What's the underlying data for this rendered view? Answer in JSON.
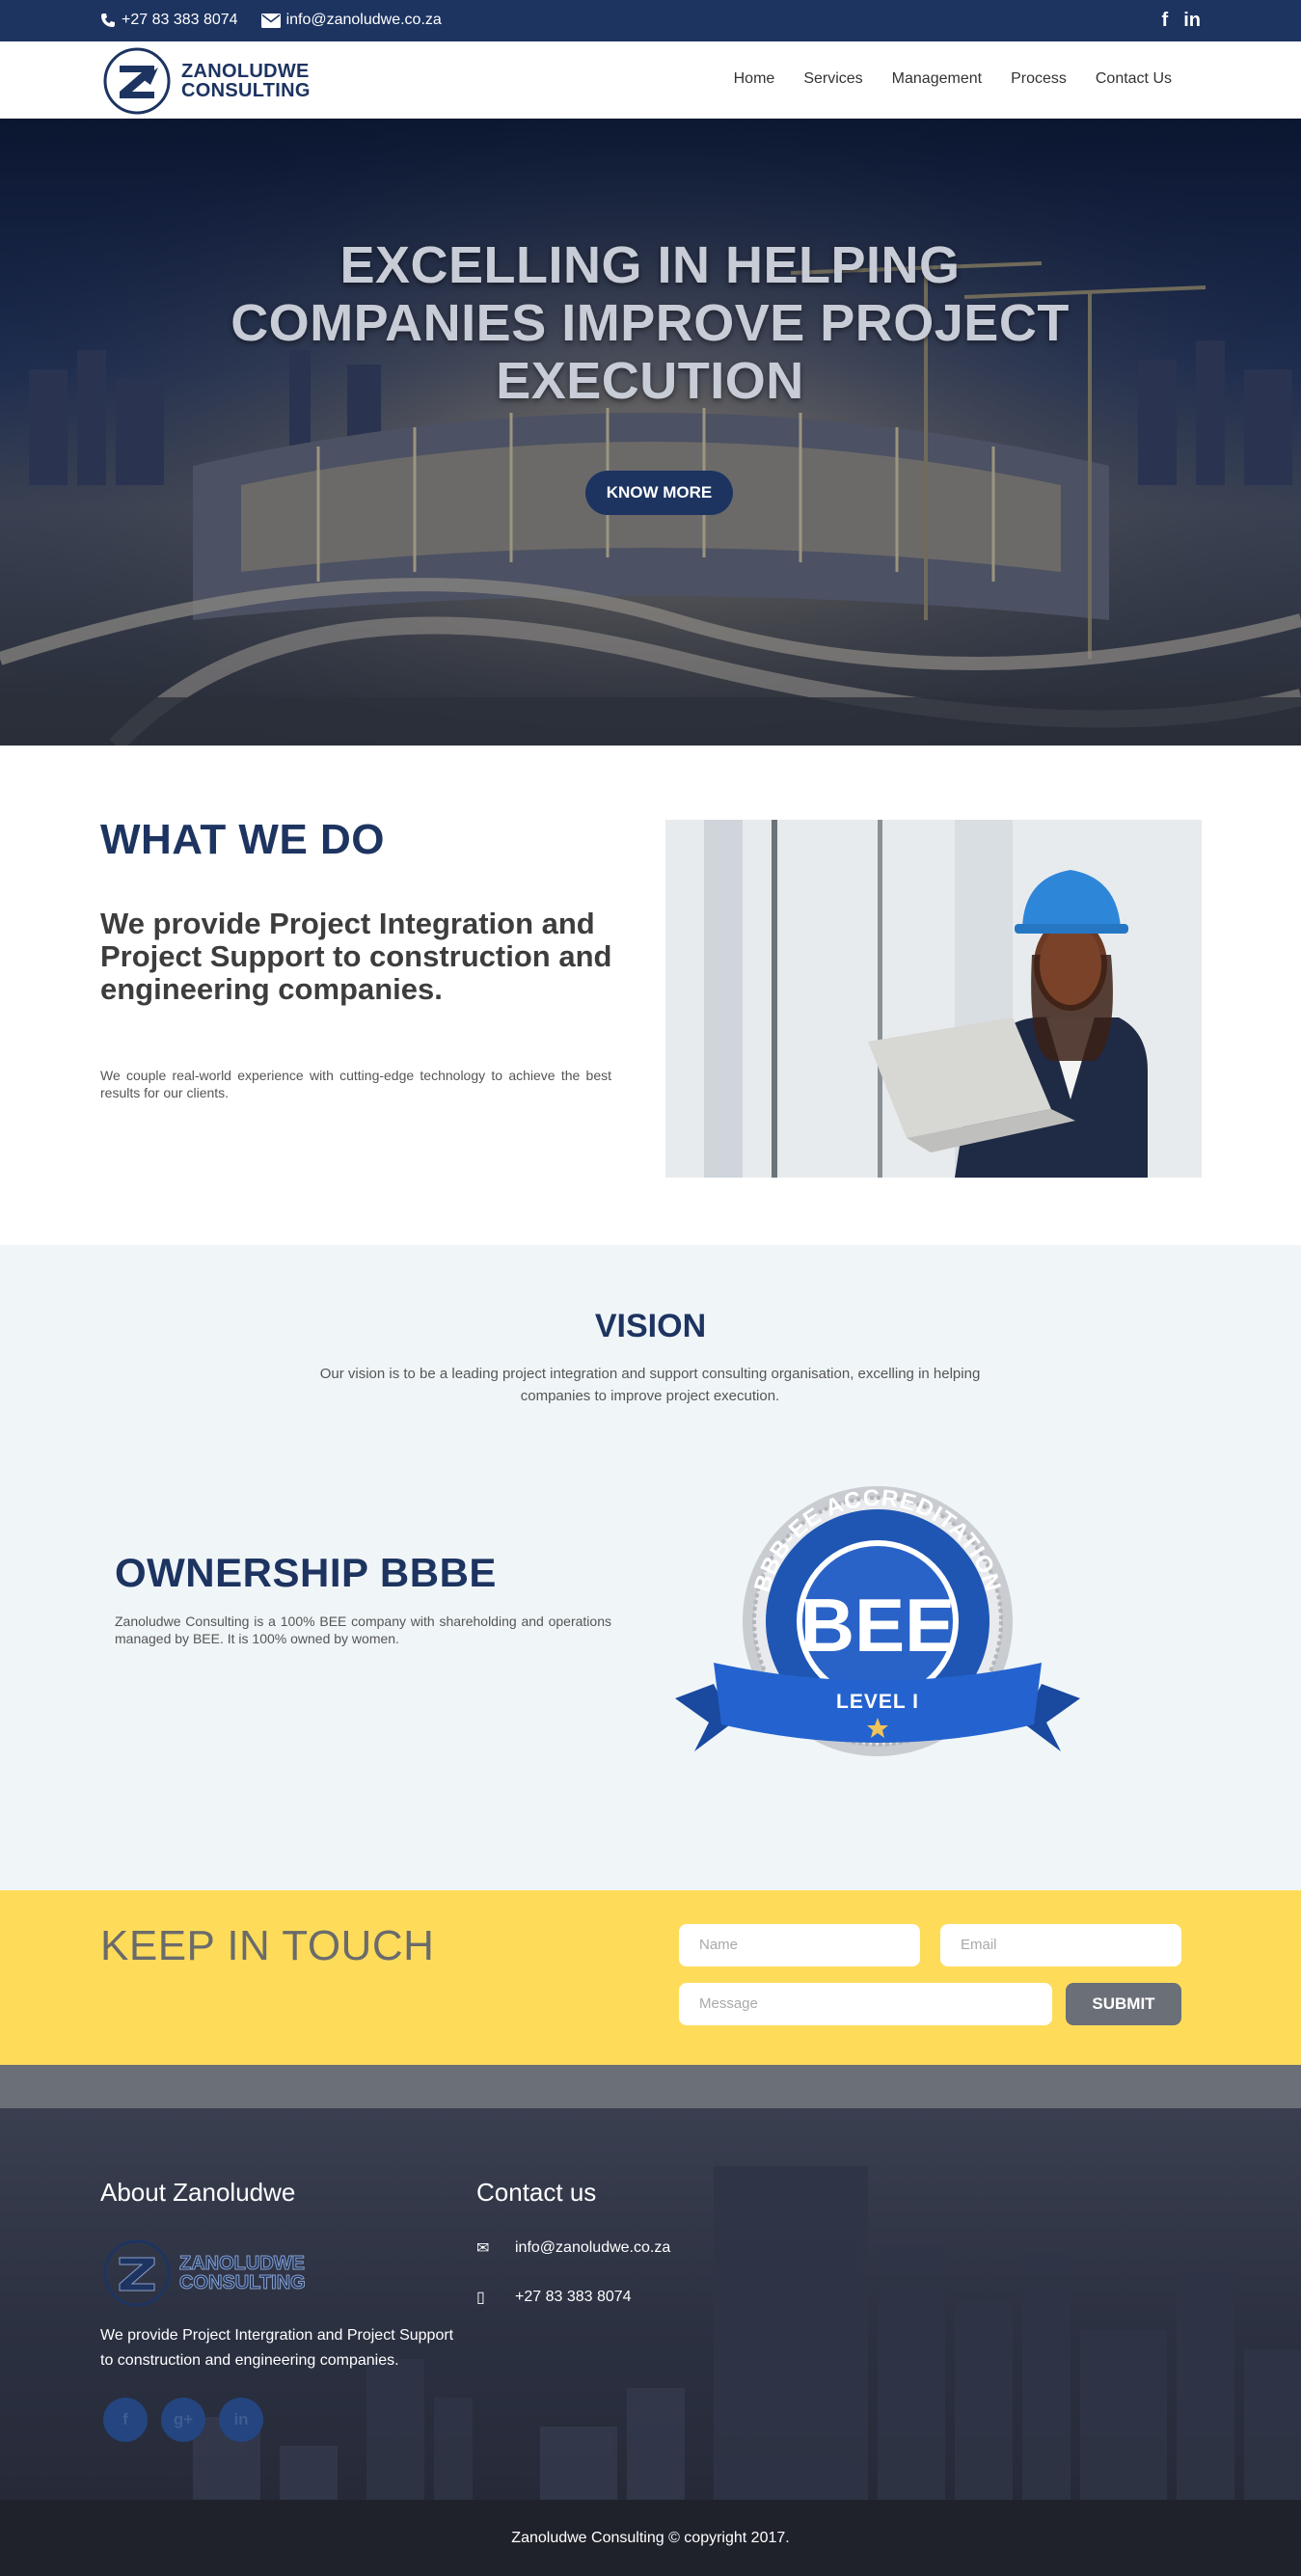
{
  "topbar": {
    "phone": "+27 83 383 8074",
    "email": "info@zanoludwe.co.za",
    "social": [
      {
        "icon": "facebook-icon",
        "glyph": "f"
      },
      {
        "icon": "linkedin-icon",
        "glyph": "in"
      }
    ]
  },
  "brand": {
    "line1": "ZANOLUDWE",
    "line2": "CONSULTING",
    "mark_letter": "Z"
  },
  "nav": {
    "items": [
      "Home",
      "Services",
      "Management",
      "Process",
      "Contact Us"
    ]
  },
  "hero": {
    "headline": "EXCELLING IN HELPING COMPANIES IMPROVE PROJECT EXECUTION",
    "button": "KNOW MORE"
  },
  "what_we_do": {
    "title": "WHAT WE DO",
    "lead": "We provide Project Integration and Project Support to construction and engineering companies.",
    "body": "We couple real-world experience with cutting-edge technology to achieve the best results for our clients."
  },
  "vision": {
    "title": "VISION",
    "text": "Our vision is to be a leading project integration and support consulting organisation, excelling in helping companies to improve project execution."
  },
  "ownership": {
    "title": "OWNERSHIP BBBE",
    "text": "Zanoludwe Consulting is a 100% BEE company with shareholding and operations managed by BEE. It is 100% owned by women.",
    "badge": {
      "arc_text": "BBB-EE ACCREDITATION",
      "center": "BEE",
      "ribbon": "LEVEL I"
    }
  },
  "keep_in_touch": {
    "title": "KEEP IN TOUCH",
    "name_placeholder": "Name",
    "email_placeholder": "Email",
    "message_placeholder": "Message",
    "submit": "SUBMIT"
  },
  "footer": {
    "about_title": "About Zanoludwe",
    "about_text": "We provide Project Intergration and Project Support to construction and engineering companies.",
    "contact_title": "Contact us",
    "email": "info@zanoludwe.co.za",
    "phone": "+27 83 383 8074",
    "social": [
      {
        "icon": "facebook-icon",
        "glyph": "f"
      },
      {
        "icon": "google-plus-icon",
        "glyph": "g+"
      },
      {
        "icon": "linkedin-icon",
        "glyph": "in"
      }
    ],
    "copyright": "Zanoludwe Consulting © copyright 2017."
  },
  "colors": {
    "navy": "#1d3461",
    "yellow": "#fedc5a",
    "light_bg": "#f0f5f8",
    "gray_button": "#6b6f78"
  }
}
